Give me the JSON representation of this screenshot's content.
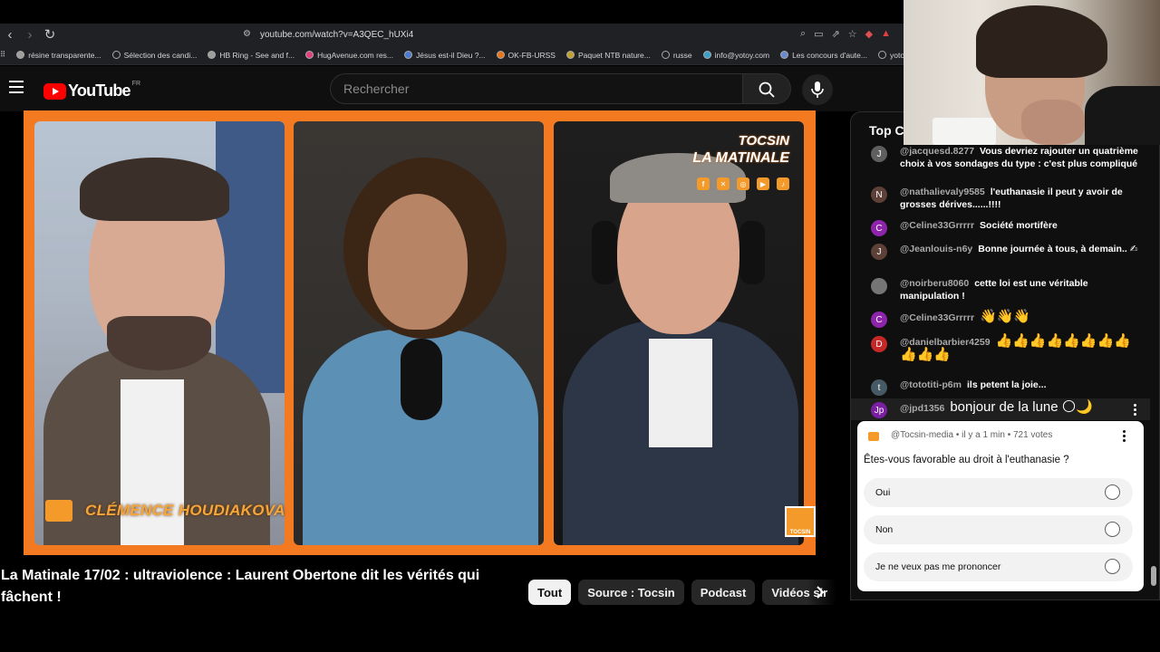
{
  "browser": {
    "url": "youtube.com/watch?v=A3QEC_hUXi4",
    "bookmarks": [
      {
        "label": "résine transparente...",
        "color": "#9e9e9e"
      },
      {
        "label": "Sélection des candi...",
        "color": "#202124"
      },
      {
        "label": "HB Ring - See and f...",
        "color": "#9e9e9e"
      },
      {
        "label": "HugAvenue.com res...",
        "color": "#e0407a"
      },
      {
        "label": "Jésus est-il Dieu ?...",
        "color": "#4a7bd0"
      },
      {
        "label": "OK-FB-URSS",
        "color": "#e8751a"
      },
      {
        "label": "Paquet NTB nature...",
        "color": "#c0a030"
      },
      {
        "label": "russe",
        "color": "#202124"
      },
      {
        "label": "info@yotoy.com",
        "color": "#3aa0c8"
      },
      {
        "label": "Les concours d'aute...",
        "color": "#6a8ad0"
      },
      {
        "label": "yotoy",
        "color": "#202124"
      }
    ]
  },
  "youtube": {
    "logo_text": "YouTube",
    "country_code": "FR",
    "search_placeholder": "Rechercher"
  },
  "video": {
    "brand_line1": "TOCSIN",
    "brand_line2": "LA MATINALE",
    "social_icons": [
      "facebook-icon",
      "x-icon",
      "instagram-icon",
      "youtube-icon",
      "tiktok-icon"
    ],
    "name_banner": "CLÉMENCE HOUDIAKOVA",
    "corner_logo_text": "TOCSIN",
    "title": "La Matinale 17/02 : ultraviolence : Laurent Obertone dit les vérités qui fâchent !"
  },
  "chips": [
    "Tout",
    "Source : Tocsin",
    "Podcast",
    "Vidéos sir"
  ],
  "chat": {
    "header": "Top Ch",
    "messages": [
      {
        "initial": "J",
        "color": "#5f5f5f",
        "author": "@jacquesd.8277",
        "text": "Vous devriez rajouter un quatrième choix à vos sondages du type : c'est plus compliqué"
      },
      {
        "initial": "N",
        "color": "#5d4037",
        "author": "@nathalievaly9585",
        "text": "l'euthanasie il peut y avoir de grosses dérives......!!!!"
      },
      {
        "initial": "C",
        "color": "#8e24aa",
        "author": "@Celine33Grrrrr",
        "text": "Société mortifère"
      },
      {
        "initial": "J",
        "color": "#5d4037",
        "author": "@Jeanlouis-n6y",
        "text": "Bonne journée à tous, à demain.. ✍"
      },
      {
        "initial": "",
        "color": "#757575",
        "author": "@noirberu8060",
        "text": "cette loi est une véritable manipulation !"
      },
      {
        "initial": "C",
        "color": "#8e24aa",
        "author": "@Celine33Grrrrr",
        "text": "👋👋👋"
      },
      {
        "initial": "D",
        "color": "#c62828",
        "author": "@danielbarbier4259",
        "text": "👍👍👍👍👍👍👍👍👍👍👍"
      },
      {
        "initial": "t",
        "color": "#455a64",
        "author": "@tototiti-p6m",
        "text": "ils petent la joie..."
      },
      {
        "initial": "Jp",
        "color": "#7b1fa2",
        "author": "@jpd1356",
        "text": "bonjour de la lune 🌕🌙"
      }
    ]
  },
  "poll": {
    "meta": "@Tocsin-media • il y a 1 min • 721 votes",
    "question": "Êtes-vous favorable au droit à l'euthanasie ?",
    "options": [
      "Oui",
      "Non",
      "Je ne veux pas me prononcer"
    ]
  }
}
